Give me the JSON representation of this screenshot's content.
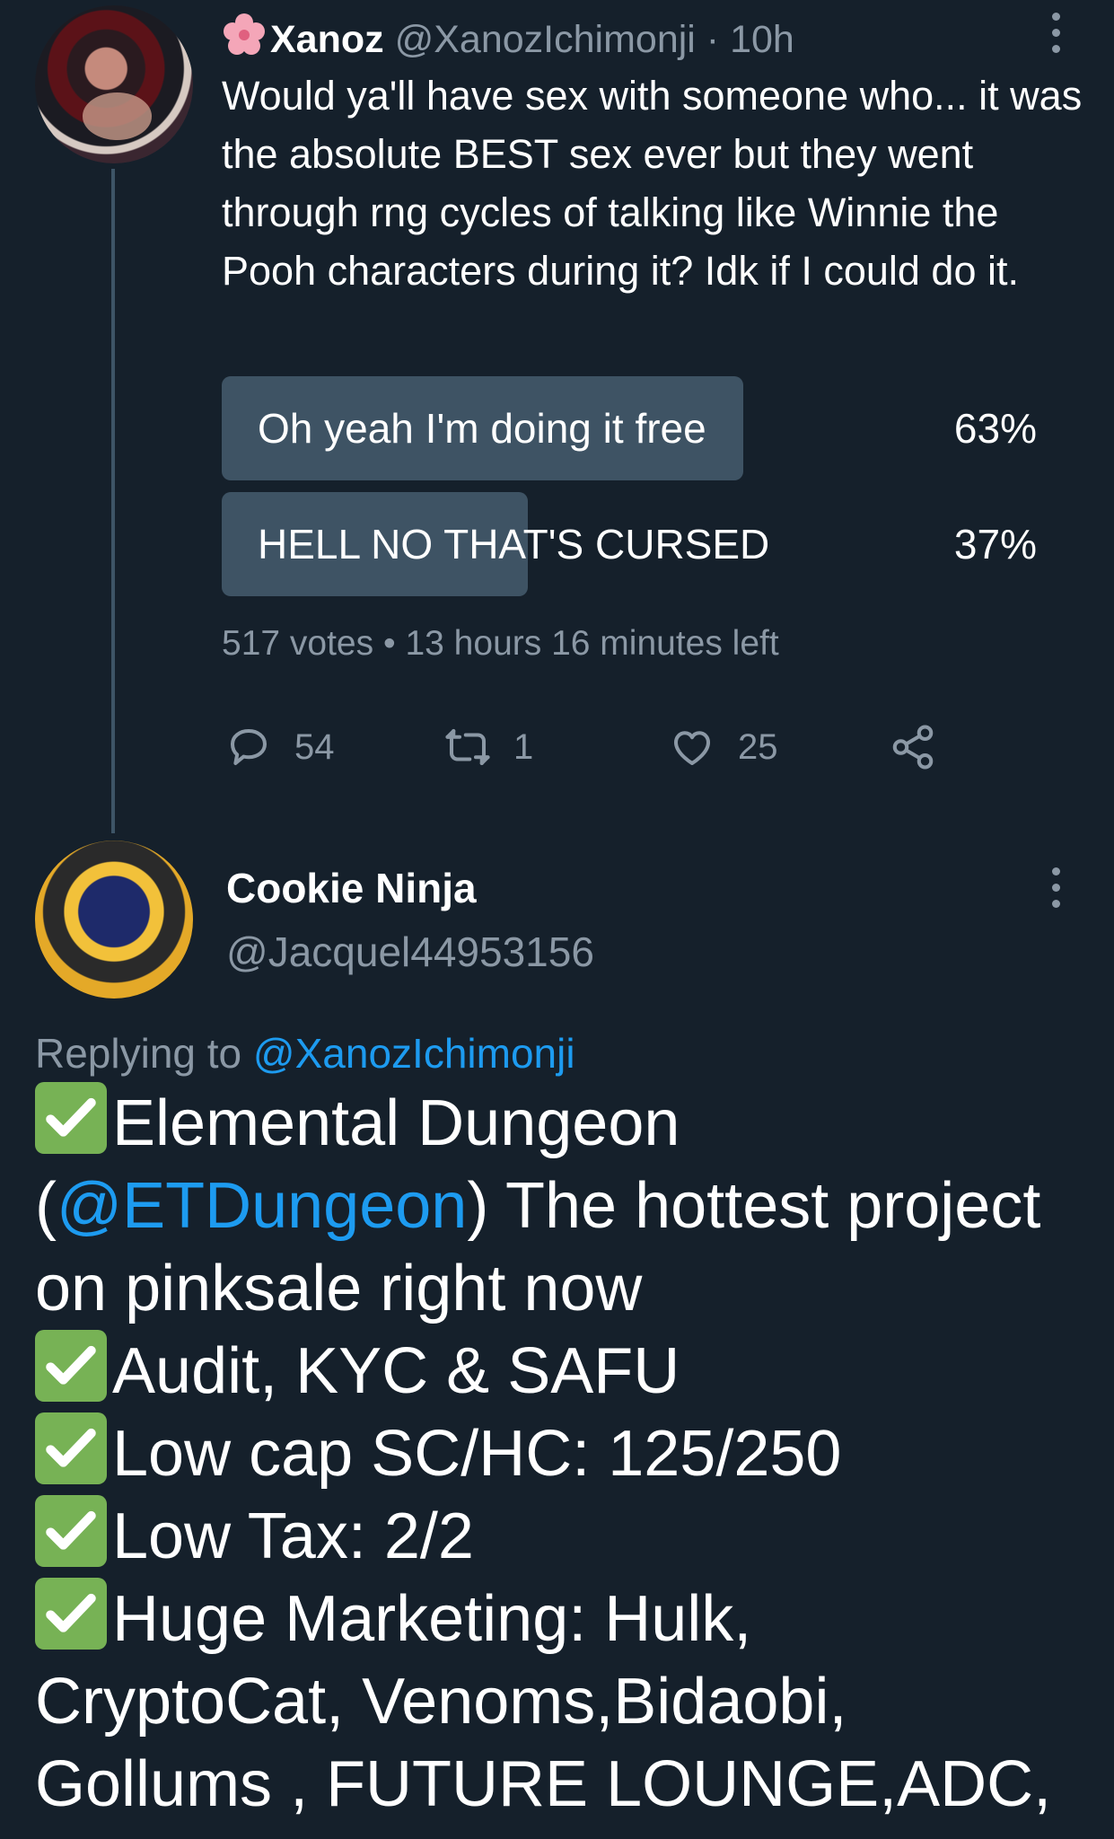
{
  "tweet": {
    "author_name": "Xanoz",
    "author_handle": "@XanozIchimonji",
    "time": "· 10h",
    "text": "Would ya'll have sex with someone who... it was the absolute BEST sex ever but they went through rng cycles of talking like Winnie the Pooh characters during it? Idk if I could do it.",
    "poll": {
      "options": [
        {
          "label": "Oh yeah I'm doing it free",
          "percent_label": "63%",
          "percent": 63
        },
        {
          "label": "HELL NO THAT'S CURSED",
          "percent_label": "37%",
          "percent": 37
        }
      ],
      "votes": "517 votes",
      "separator": "•",
      "time_left": "13 hours 16 minutes left"
    },
    "actions": {
      "replies": "54",
      "retweets": "1",
      "likes": "25"
    }
  },
  "reply": {
    "author_name": "Cookie Ninja",
    "author_handle": "@Jacquel44953156",
    "replying_prefix": "Replying to ",
    "replying_to": "@XanozIchimonji",
    "lines": {
      "l1": "Elemental Dungeon",
      "l2_open": "(",
      "l2_link": "@ETDungeon",
      "l2_rest": ") The hottest project",
      "l3": "on pinksale right now",
      "l4": "Audit, KYC & SAFU",
      "l5": "Low cap SC/HC: 125/250",
      "l6": "Low Tax: 2/2",
      "l7": "Huge Marketing: Hulk,",
      "l8": "CryptoCat, Venoms,Bidaobi,",
      "l9": "Gollums , FUTURE LOUNGE,ADC,"
    }
  },
  "icons": [
    "cherry-blossom-icon",
    "more-icon",
    "reply-icon",
    "retweet-icon",
    "like-icon",
    "share-icon",
    "check-mark-icon"
  ],
  "colors": {
    "background": "#15202b",
    "muted_text": "#8b98a5",
    "link": "#1d9bf0",
    "poll_bar": "#3e5364",
    "check_green": "#77b255"
  }
}
